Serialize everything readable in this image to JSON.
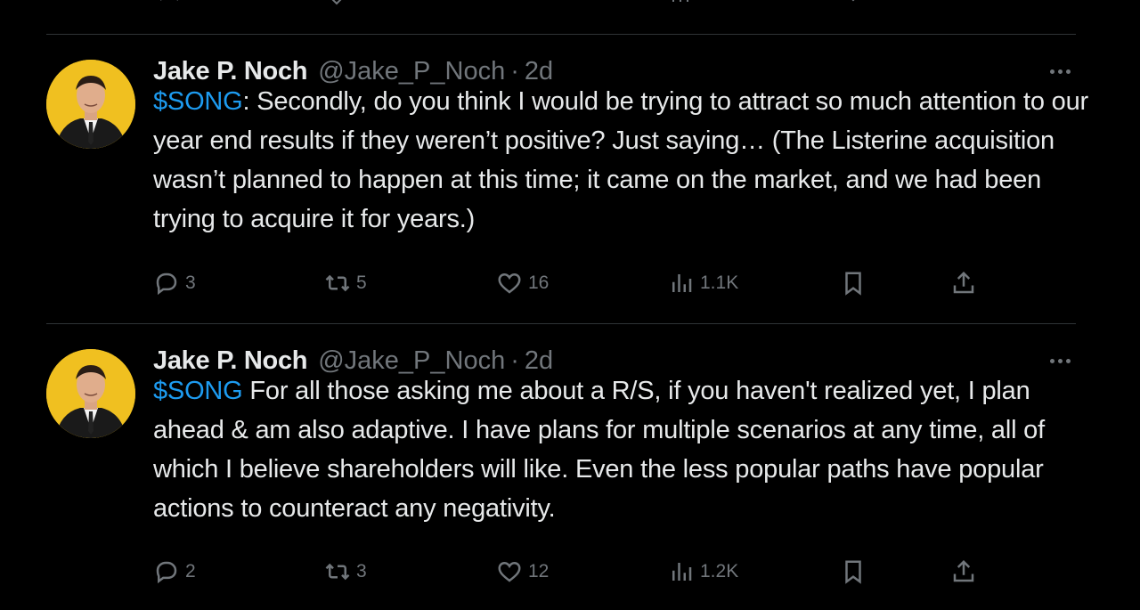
{
  "tweets": [
    {
      "name": "Jake P. Noch",
      "handle": "@Jake_P_Noch",
      "separator": "·",
      "time": "2d",
      "cashtag": "$SONG",
      "text": ": Secondly, do you think I would be trying to attract so much attention to our year end results if they weren’t positive? Just saying… (The Listerine acquisition wasn’t planned to happen at this time; it came on the market, and we had been trying to acquire it for years.)",
      "replies": "3",
      "reposts": "5",
      "likes": "16",
      "views": "1.1K"
    },
    {
      "name": "Jake P. Noch",
      "handle": "@Jake_P_Noch",
      "separator": "·",
      "time": "2d",
      "cashtag": "$SONG",
      "text": " For all those asking me about a R/S, if you haven't realized yet, I plan ahead & am also adaptive. I have plans for multiple scenarios at any time, all of which I believe shareholders will like. Even the less popular paths have popular actions to counteract any negativity.",
      "replies": "2",
      "reposts": "3",
      "likes": "12",
      "views": "1.2K"
    }
  ],
  "icons": {
    "reply": "speech-bubble-icon",
    "repost": "repost-arrows-icon",
    "like": "heart-icon",
    "views": "bar-chart-icon",
    "bookmark": "bookmark-icon",
    "share": "share-upload-icon",
    "more": "more-dots-icon"
  },
  "colors": {
    "background": "#000000",
    "text": "#e7e9ea",
    "muted": "#71767b",
    "accent": "#1d9bf0",
    "avatar_bg": "#f0c020"
  }
}
